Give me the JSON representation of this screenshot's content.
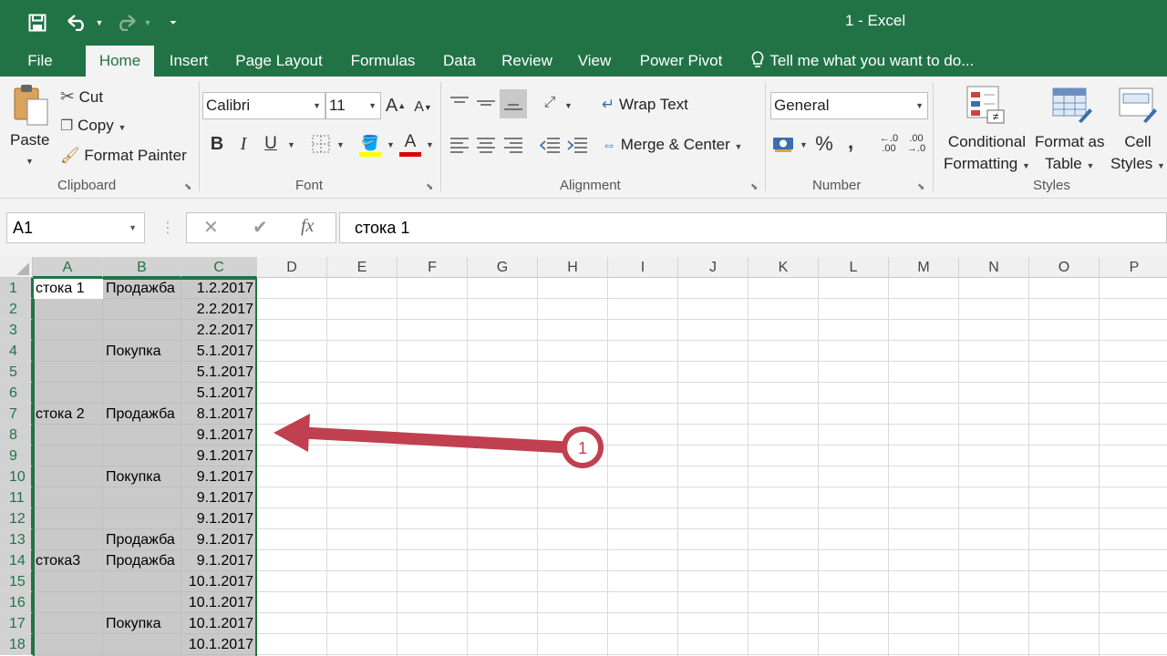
{
  "app": {
    "title": "1 - Excel"
  },
  "tabs": [
    "File",
    "Home",
    "Insert",
    "Page Layout",
    "Formulas",
    "Data",
    "Review",
    "View",
    "Power Pivot"
  ],
  "tell_me": "Tell me what you want to do...",
  "ribbon": {
    "clipboard": {
      "paste": "Paste",
      "cut": "Cut",
      "copy": "Copy",
      "format_painter": "Format Painter",
      "group": "Clipboard"
    },
    "font": {
      "name": "Calibri",
      "size": "11",
      "group": "Font",
      "highlight_color": "#ffff00",
      "font_color": "#e00000"
    },
    "alignment": {
      "wrap": "Wrap Text",
      "merge": "Merge & Center",
      "group": "Alignment"
    },
    "number": {
      "format": "General",
      "group": "Number"
    },
    "styles": {
      "cond1": "Conditional",
      "cond2": "Formatting",
      "fat1": "Format as",
      "fat2": "Table",
      "cs1": "Cell",
      "cs2": "Styles",
      "group": "Styles"
    }
  },
  "formula_bar": {
    "name_box": "A1",
    "value": "стока 1"
  },
  "columns": [
    "A",
    "B",
    "C",
    "D",
    "E",
    "F",
    "G",
    "H",
    "I",
    "J",
    "K",
    "L",
    "M",
    "N",
    "O",
    "P"
  ],
  "rows": [
    [
      "стока 1",
      "Продажба",
      "1.2.2017"
    ],
    [
      "",
      "",
      "2.2.2017"
    ],
    [
      "",
      "",
      "2.2.2017"
    ],
    [
      "",
      "Покупка",
      "5.1.2017"
    ],
    [
      "",
      "",
      "5.1.2017"
    ],
    [
      "",
      "",
      "5.1.2017"
    ],
    [
      "стока 2",
      "Продажба",
      "8.1.2017"
    ],
    [
      "",
      "",
      "9.1.2017"
    ],
    [
      "",
      "",
      "9.1.2017"
    ],
    [
      "",
      "Покупка",
      "9.1.2017"
    ],
    [
      "",
      "",
      "9.1.2017"
    ],
    [
      "",
      "",
      "9.1.2017"
    ],
    [
      "",
      "Продажба",
      "9.1.2017"
    ],
    [
      "стока3",
      "Продажба",
      "9.1.2017"
    ],
    [
      "",
      "",
      "10.1.2017"
    ],
    [
      "",
      "",
      "10.1.2017"
    ],
    [
      "",
      "Покупка",
      "10.1.2017"
    ],
    [
      "",
      "",
      "10.1.2017"
    ]
  ],
  "annotation": {
    "number": "1",
    "color": "#c0404f"
  },
  "colors": {
    "excel_green": "#217346"
  }
}
